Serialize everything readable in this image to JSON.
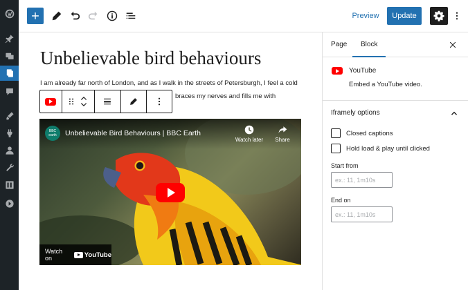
{
  "topbar": {
    "preview_label": "Preview",
    "update_label": "Update"
  },
  "editor": {
    "post_title": "Unbelievable bird behaviours",
    "paragraph_line1": "I am already far north of London, and as I walk in the streets of Petersburgh, I feel a cold",
    "paragraph_line2": "braces my nerves and fills me with"
  },
  "embed": {
    "video_title": "Unbelievable Bird Behaviours | BBC Earth",
    "channel_logo_text": "BBC earth",
    "watch_later_label": "Watch later",
    "share_label": "Share",
    "watch_on_label": "Watch on",
    "youtube_logo_text": "YouTube"
  },
  "sidebar": {
    "tabs": [
      {
        "label": "Page",
        "active": false
      },
      {
        "label": "Block",
        "active": true
      }
    ],
    "block": {
      "name": "YouTube",
      "description": "Embed a YouTube video."
    },
    "panel_title": "Iframely options",
    "options": {
      "closed_captions": "Closed captions",
      "hold_load": "Hold load & play until clicked",
      "start_from_label": "Start from",
      "start_from_placeholder": "ex.: 11, 1m10s",
      "end_on_label": "End on",
      "end_on_placeholder": "ex.: 11, 1m10s"
    }
  },
  "colors": {
    "accent": "#2271b1",
    "admin_bar": "#1d2327",
    "youtube_red": "#ff0000"
  }
}
